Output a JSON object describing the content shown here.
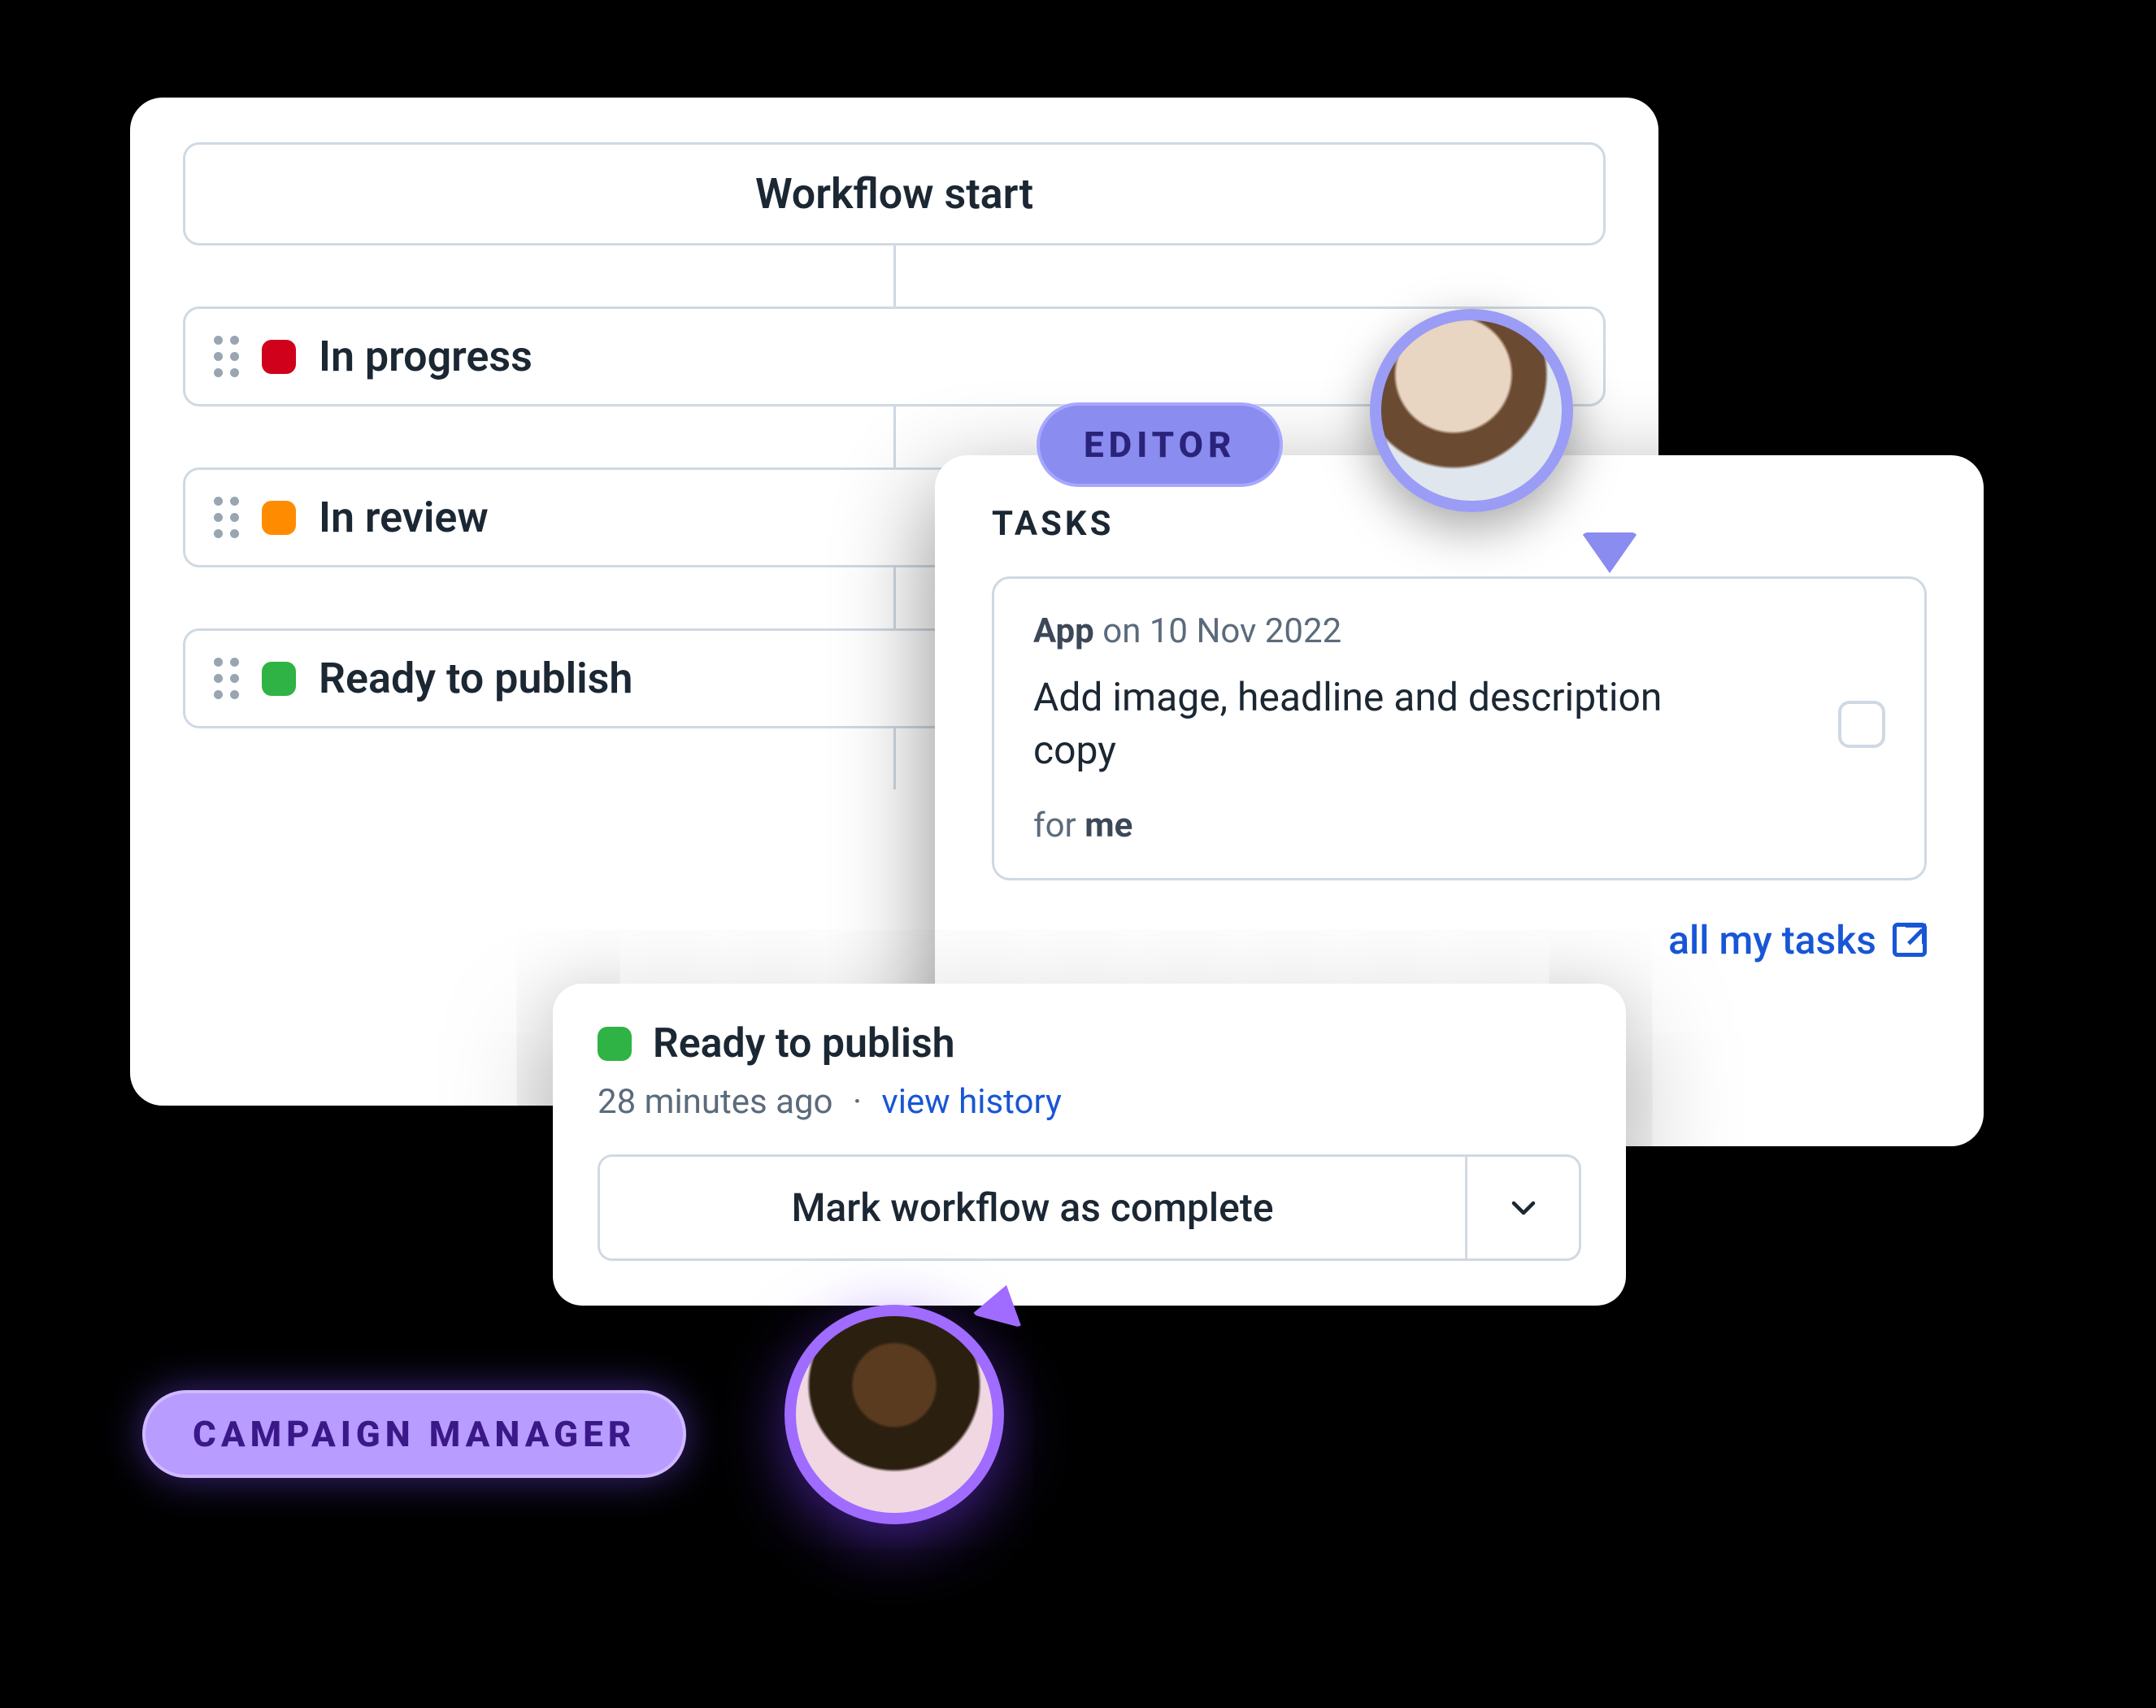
{
  "workflow": {
    "start_label": "Workflow start",
    "stages": [
      {
        "label": "In progress",
        "color": "#d0021b"
      },
      {
        "label": "In review",
        "color": "#ff8c00"
      },
      {
        "label": "Ready to publish",
        "color": "#2fb344"
      }
    ]
  },
  "tasks_panel": {
    "title": "TASKS",
    "card": {
      "source": "App",
      "on_word": "on",
      "date": "10 Nov 2022",
      "text": "Add image, headline and description copy",
      "for_word": "for",
      "assignee": "me"
    },
    "all_link": "all my tasks"
  },
  "status_popover": {
    "status": "Ready to publish",
    "ago": "28 minutes ago",
    "separator": "·",
    "history_link": "view history",
    "action_label": "Mark workflow as complete"
  },
  "roles": {
    "editor": "EDITOR",
    "campaign_manager": "CAMPAIGN MANAGER"
  }
}
